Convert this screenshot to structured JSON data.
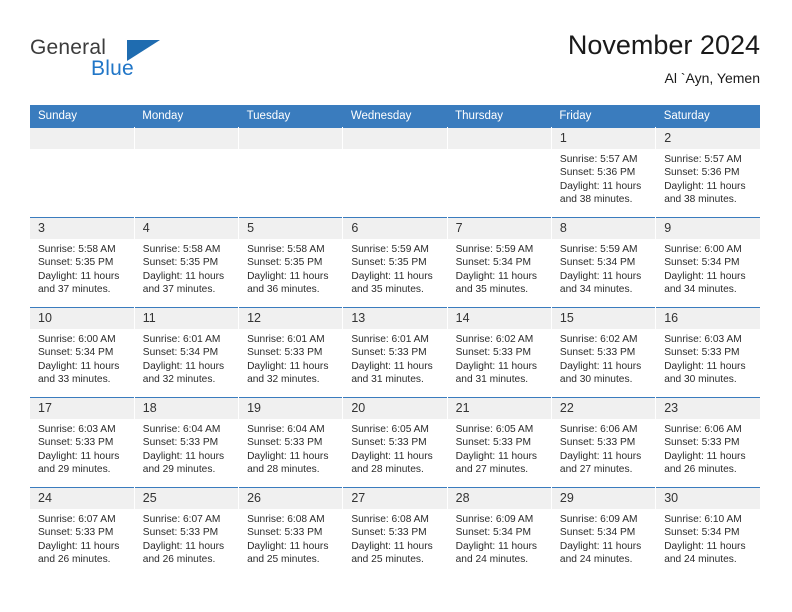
{
  "brand": {
    "name_part1": "General",
    "name_part2": "Blue",
    "flag_icon": "triangle-flag-icon"
  },
  "header": {
    "title": "November 2024",
    "subtitle": "Al `Ayn, Yemen"
  },
  "calendar": {
    "weekday_headers": [
      "Sunday",
      "Monday",
      "Tuesday",
      "Wednesday",
      "Thursday",
      "Friday",
      "Saturday"
    ],
    "colors": {
      "header_blue": "#3a7cbe",
      "daynum_grey": "#f0f0f0",
      "brand_blue": "#2176c7",
      "text": "#2b2b2b"
    },
    "weeks": [
      [
        {
          "day": "",
          "sunrise": "",
          "sunset": "",
          "daylight_line1": "",
          "daylight_line2": "",
          "empty": true
        },
        {
          "day": "",
          "sunrise": "",
          "sunset": "",
          "daylight_line1": "",
          "daylight_line2": "",
          "empty": true
        },
        {
          "day": "",
          "sunrise": "",
          "sunset": "",
          "daylight_line1": "",
          "daylight_line2": "",
          "empty": true
        },
        {
          "day": "",
          "sunrise": "",
          "sunset": "",
          "daylight_line1": "",
          "daylight_line2": "",
          "empty": true
        },
        {
          "day": "",
          "sunrise": "",
          "sunset": "",
          "daylight_line1": "",
          "daylight_line2": "",
          "empty": true
        },
        {
          "day": "1",
          "sunrise": "Sunrise: 5:57 AM",
          "sunset": "Sunset: 5:36 PM",
          "daylight_line1": "Daylight: 11 hours",
          "daylight_line2": "and 38 minutes."
        },
        {
          "day": "2",
          "sunrise": "Sunrise: 5:57 AM",
          "sunset": "Sunset: 5:36 PM",
          "daylight_line1": "Daylight: 11 hours",
          "daylight_line2": "and 38 minutes."
        }
      ],
      [
        {
          "day": "3",
          "sunrise": "Sunrise: 5:58 AM",
          "sunset": "Sunset: 5:35 PM",
          "daylight_line1": "Daylight: 11 hours",
          "daylight_line2": "and 37 minutes."
        },
        {
          "day": "4",
          "sunrise": "Sunrise: 5:58 AM",
          "sunset": "Sunset: 5:35 PM",
          "daylight_line1": "Daylight: 11 hours",
          "daylight_line2": "and 37 minutes."
        },
        {
          "day": "5",
          "sunrise": "Sunrise: 5:58 AM",
          "sunset": "Sunset: 5:35 PM",
          "daylight_line1": "Daylight: 11 hours",
          "daylight_line2": "and 36 minutes."
        },
        {
          "day": "6",
          "sunrise": "Sunrise: 5:59 AM",
          "sunset": "Sunset: 5:35 PM",
          "daylight_line1": "Daylight: 11 hours",
          "daylight_line2": "and 35 minutes."
        },
        {
          "day": "7",
          "sunrise": "Sunrise: 5:59 AM",
          "sunset": "Sunset: 5:34 PM",
          "daylight_line1": "Daylight: 11 hours",
          "daylight_line2": "and 35 minutes."
        },
        {
          "day": "8",
          "sunrise": "Sunrise: 5:59 AM",
          "sunset": "Sunset: 5:34 PM",
          "daylight_line1": "Daylight: 11 hours",
          "daylight_line2": "and 34 minutes."
        },
        {
          "day": "9",
          "sunrise": "Sunrise: 6:00 AM",
          "sunset": "Sunset: 5:34 PM",
          "daylight_line1": "Daylight: 11 hours",
          "daylight_line2": "and 34 minutes."
        }
      ],
      [
        {
          "day": "10",
          "sunrise": "Sunrise: 6:00 AM",
          "sunset": "Sunset: 5:34 PM",
          "daylight_line1": "Daylight: 11 hours",
          "daylight_line2": "and 33 minutes."
        },
        {
          "day": "11",
          "sunrise": "Sunrise: 6:01 AM",
          "sunset": "Sunset: 5:34 PM",
          "daylight_line1": "Daylight: 11 hours",
          "daylight_line2": "and 32 minutes."
        },
        {
          "day": "12",
          "sunrise": "Sunrise: 6:01 AM",
          "sunset": "Sunset: 5:33 PM",
          "daylight_line1": "Daylight: 11 hours",
          "daylight_line2": "and 32 minutes."
        },
        {
          "day": "13",
          "sunrise": "Sunrise: 6:01 AM",
          "sunset": "Sunset: 5:33 PM",
          "daylight_line1": "Daylight: 11 hours",
          "daylight_line2": "and 31 minutes."
        },
        {
          "day": "14",
          "sunrise": "Sunrise: 6:02 AM",
          "sunset": "Sunset: 5:33 PM",
          "daylight_line1": "Daylight: 11 hours",
          "daylight_line2": "and 31 minutes."
        },
        {
          "day": "15",
          "sunrise": "Sunrise: 6:02 AM",
          "sunset": "Sunset: 5:33 PM",
          "daylight_line1": "Daylight: 11 hours",
          "daylight_line2": "and 30 minutes."
        },
        {
          "day": "16",
          "sunrise": "Sunrise: 6:03 AM",
          "sunset": "Sunset: 5:33 PM",
          "daylight_line1": "Daylight: 11 hours",
          "daylight_line2": "and 30 minutes."
        }
      ],
      [
        {
          "day": "17",
          "sunrise": "Sunrise: 6:03 AM",
          "sunset": "Sunset: 5:33 PM",
          "daylight_line1": "Daylight: 11 hours",
          "daylight_line2": "and 29 minutes."
        },
        {
          "day": "18",
          "sunrise": "Sunrise: 6:04 AM",
          "sunset": "Sunset: 5:33 PM",
          "daylight_line1": "Daylight: 11 hours",
          "daylight_line2": "and 29 minutes."
        },
        {
          "day": "19",
          "sunrise": "Sunrise: 6:04 AM",
          "sunset": "Sunset: 5:33 PM",
          "daylight_line1": "Daylight: 11 hours",
          "daylight_line2": "and 28 minutes."
        },
        {
          "day": "20",
          "sunrise": "Sunrise: 6:05 AM",
          "sunset": "Sunset: 5:33 PM",
          "daylight_line1": "Daylight: 11 hours",
          "daylight_line2": "and 28 minutes."
        },
        {
          "day": "21",
          "sunrise": "Sunrise: 6:05 AM",
          "sunset": "Sunset: 5:33 PM",
          "daylight_line1": "Daylight: 11 hours",
          "daylight_line2": "and 27 minutes."
        },
        {
          "day": "22",
          "sunrise": "Sunrise: 6:06 AM",
          "sunset": "Sunset: 5:33 PM",
          "daylight_line1": "Daylight: 11 hours",
          "daylight_line2": "and 27 minutes."
        },
        {
          "day": "23",
          "sunrise": "Sunrise: 6:06 AM",
          "sunset": "Sunset: 5:33 PM",
          "daylight_line1": "Daylight: 11 hours",
          "daylight_line2": "and 26 minutes."
        }
      ],
      [
        {
          "day": "24",
          "sunrise": "Sunrise: 6:07 AM",
          "sunset": "Sunset: 5:33 PM",
          "daylight_line1": "Daylight: 11 hours",
          "daylight_line2": "and 26 minutes."
        },
        {
          "day": "25",
          "sunrise": "Sunrise: 6:07 AM",
          "sunset": "Sunset: 5:33 PM",
          "daylight_line1": "Daylight: 11 hours",
          "daylight_line2": "and 26 minutes."
        },
        {
          "day": "26",
          "sunrise": "Sunrise: 6:08 AM",
          "sunset": "Sunset: 5:33 PM",
          "daylight_line1": "Daylight: 11 hours",
          "daylight_line2": "and 25 minutes."
        },
        {
          "day": "27",
          "sunrise": "Sunrise: 6:08 AM",
          "sunset": "Sunset: 5:33 PM",
          "daylight_line1": "Daylight: 11 hours",
          "daylight_line2": "and 25 minutes."
        },
        {
          "day": "28",
          "sunrise": "Sunrise: 6:09 AM",
          "sunset": "Sunset: 5:34 PM",
          "daylight_line1": "Daylight: 11 hours",
          "daylight_line2": "and 24 minutes."
        },
        {
          "day": "29",
          "sunrise": "Sunrise: 6:09 AM",
          "sunset": "Sunset: 5:34 PM",
          "daylight_line1": "Daylight: 11 hours",
          "daylight_line2": "and 24 minutes."
        },
        {
          "day": "30",
          "sunrise": "Sunrise: 6:10 AM",
          "sunset": "Sunset: 5:34 PM",
          "daylight_line1": "Daylight: 11 hours",
          "daylight_line2": "and 24 minutes."
        }
      ]
    ]
  }
}
